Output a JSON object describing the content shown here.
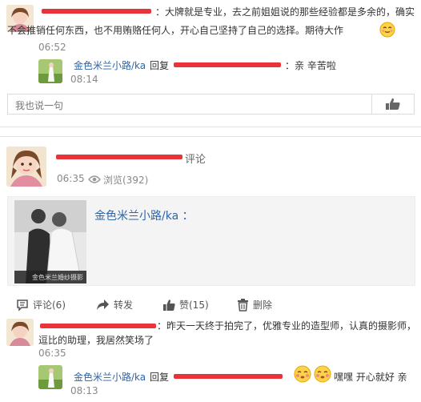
{
  "comment1": {
    "text_line1": "：大牌就是专业，去之前姐姐说的那些经验都是多余的，确实",
    "text_line2": "不会推销任何东西，也不用贿赂任何人，开心自己坚持了自己的选择。期待大作",
    "time": "06:52",
    "reply": {
      "name": "金色米兰小路/ka",
      "reply_label": "回复",
      "text": "：亲 辛苦啦",
      "time": "08:14"
    }
  },
  "input": {
    "placeholder": "我也说一句"
  },
  "post": {
    "action": "评论",
    "time": "06:35",
    "views_label": "浏览(392)",
    "shared_author": "金色米兰小路/ka ：",
    "photo_caption": "金色米兰婚纱摄影"
  },
  "actions": {
    "comment": "评论(6)",
    "forward": "转发",
    "like": "赞(15)",
    "delete": "删除"
  },
  "comment2": {
    "text_line1": "：昨天一天终于拍完了，优雅专业的造型师，认真的摄影师，",
    "text_line2": "逗比的助理，我居然笑场了",
    "time": "06:35",
    "reply": {
      "name": "金色米兰小路/ka",
      "reply_label": "回复",
      "text": "嘿嘿 开心就好 亲",
      "time": "08:13"
    }
  },
  "colors": {
    "blue": "#2f64a6",
    "redaction": "#e8333a",
    "gray": "#888888"
  }
}
